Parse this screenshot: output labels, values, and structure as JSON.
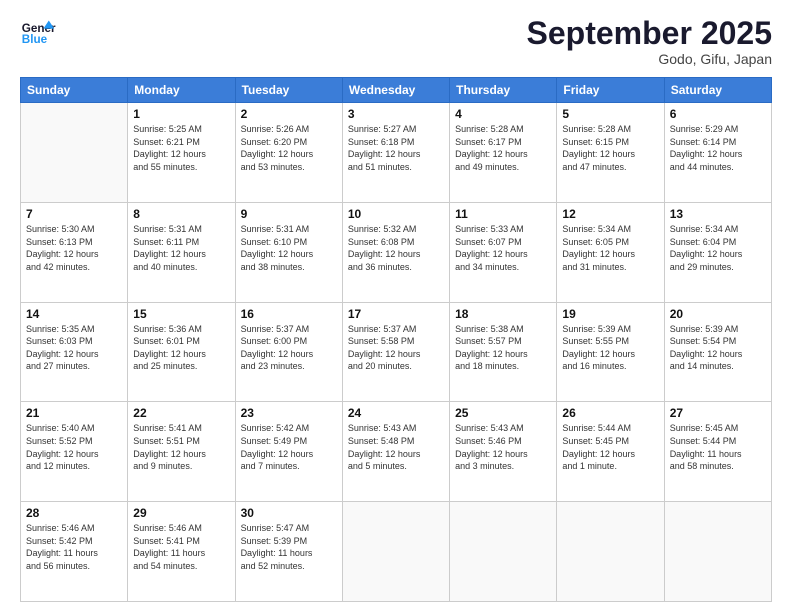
{
  "logo": {
    "line1": "General",
    "line2": "Blue"
  },
  "title": "September 2025",
  "location": "Godo, Gifu, Japan",
  "weekdays": [
    "Sunday",
    "Monday",
    "Tuesday",
    "Wednesday",
    "Thursday",
    "Friday",
    "Saturday"
  ],
  "weeks": [
    [
      {
        "num": "",
        "info": ""
      },
      {
        "num": "1",
        "info": "Sunrise: 5:25 AM\nSunset: 6:21 PM\nDaylight: 12 hours\nand 55 minutes."
      },
      {
        "num": "2",
        "info": "Sunrise: 5:26 AM\nSunset: 6:20 PM\nDaylight: 12 hours\nand 53 minutes."
      },
      {
        "num": "3",
        "info": "Sunrise: 5:27 AM\nSunset: 6:18 PM\nDaylight: 12 hours\nand 51 minutes."
      },
      {
        "num": "4",
        "info": "Sunrise: 5:28 AM\nSunset: 6:17 PM\nDaylight: 12 hours\nand 49 minutes."
      },
      {
        "num": "5",
        "info": "Sunrise: 5:28 AM\nSunset: 6:15 PM\nDaylight: 12 hours\nand 47 minutes."
      },
      {
        "num": "6",
        "info": "Sunrise: 5:29 AM\nSunset: 6:14 PM\nDaylight: 12 hours\nand 44 minutes."
      }
    ],
    [
      {
        "num": "7",
        "info": "Sunrise: 5:30 AM\nSunset: 6:13 PM\nDaylight: 12 hours\nand 42 minutes."
      },
      {
        "num": "8",
        "info": "Sunrise: 5:31 AM\nSunset: 6:11 PM\nDaylight: 12 hours\nand 40 minutes."
      },
      {
        "num": "9",
        "info": "Sunrise: 5:31 AM\nSunset: 6:10 PM\nDaylight: 12 hours\nand 38 minutes."
      },
      {
        "num": "10",
        "info": "Sunrise: 5:32 AM\nSunset: 6:08 PM\nDaylight: 12 hours\nand 36 minutes."
      },
      {
        "num": "11",
        "info": "Sunrise: 5:33 AM\nSunset: 6:07 PM\nDaylight: 12 hours\nand 34 minutes."
      },
      {
        "num": "12",
        "info": "Sunrise: 5:34 AM\nSunset: 6:05 PM\nDaylight: 12 hours\nand 31 minutes."
      },
      {
        "num": "13",
        "info": "Sunrise: 5:34 AM\nSunset: 6:04 PM\nDaylight: 12 hours\nand 29 minutes."
      }
    ],
    [
      {
        "num": "14",
        "info": "Sunrise: 5:35 AM\nSunset: 6:03 PM\nDaylight: 12 hours\nand 27 minutes."
      },
      {
        "num": "15",
        "info": "Sunrise: 5:36 AM\nSunset: 6:01 PM\nDaylight: 12 hours\nand 25 minutes."
      },
      {
        "num": "16",
        "info": "Sunrise: 5:37 AM\nSunset: 6:00 PM\nDaylight: 12 hours\nand 23 minutes."
      },
      {
        "num": "17",
        "info": "Sunrise: 5:37 AM\nSunset: 5:58 PM\nDaylight: 12 hours\nand 20 minutes."
      },
      {
        "num": "18",
        "info": "Sunrise: 5:38 AM\nSunset: 5:57 PM\nDaylight: 12 hours\nand 18 minutes."
      },
      {
        "num": "19",
        "info": "Sunrise: 5:39 AM\nSunset: 5:55 PM\nDaylight: 12 hours\nand 16 minutes."
      },
      {
        "num": "20",
        "info": "Sunrise: 5:39 AM\nSunset: 5:54 PM\nDaylight: 12 hours\nand 14 minutes."
      }
    ],
    [
      {
        "num": "21",
        "info": "Sunrise: 5:40 AM\nSunset: 5:52 PM\nDaylight: 12 hours\nand 12 minutes."
      },
      {
        "num": "22",
        "info": "Sunrise: 5:41 AM\nSunset: 5:51 PM\nDaylight: 12 hours\nand 9 minutes."
      },
      {
        "num": "23",
        "info": "Sunrise: 5:42 AM\nSunset: 5:49 PM\nDaylight: 12 hours\nand 7 minutes."
      },
      {
        "num": "24",
        "info": "Sunrise: 5:43 AM\nSunset: 5:48 PM\nDaylight: 12 hours\nand 5 minutes."
      },
      {
        "num": "25",
        "info": "Sunrise: 5:43 AM\nSunset: 5:46 PM\nDaylight: 12 hours\nand 3 minutes."
      },
      {
        "num": "26",
        "info": "Sunrise: 5:44 AM\nSunset: 5:45 PM\nDaylight: 12 hours\nand 1 minute."
      },
      {
        "num": "27",
        "info": "Sunrise: 5:45 AM\nSunset: 5:44 PM\nDaylight: 11 hours\nand 58 minutes."
      }
    ],
    [
      {
        "num": "28",
        "info": "Sunrise: 5:46 AM\nSunset: 5:42 PM\nDaylight: 11 hours\nand 56 minutes."
      },
      {
        "num": "29",
        "info": "Sunrise: 5:46 AM\nSunset: 5:41 PM\nDaylight: 11 hours\nand 54 minutes."
      },
      {
        "num": "30",
        "info": "Sunrise: 5:47 AM\nSunset: 5:39 PM\nDaylight: 11 hours\nand 52 minutes."
      },
      {
        "num": "",
        "info": ""
      },
      {
        "num": "",
        "info": ""
      },
      {
        "num": "",
        "info": ""
      },
      {
        "num": "",
        "info": ""
      }
    ]
  ]
}
